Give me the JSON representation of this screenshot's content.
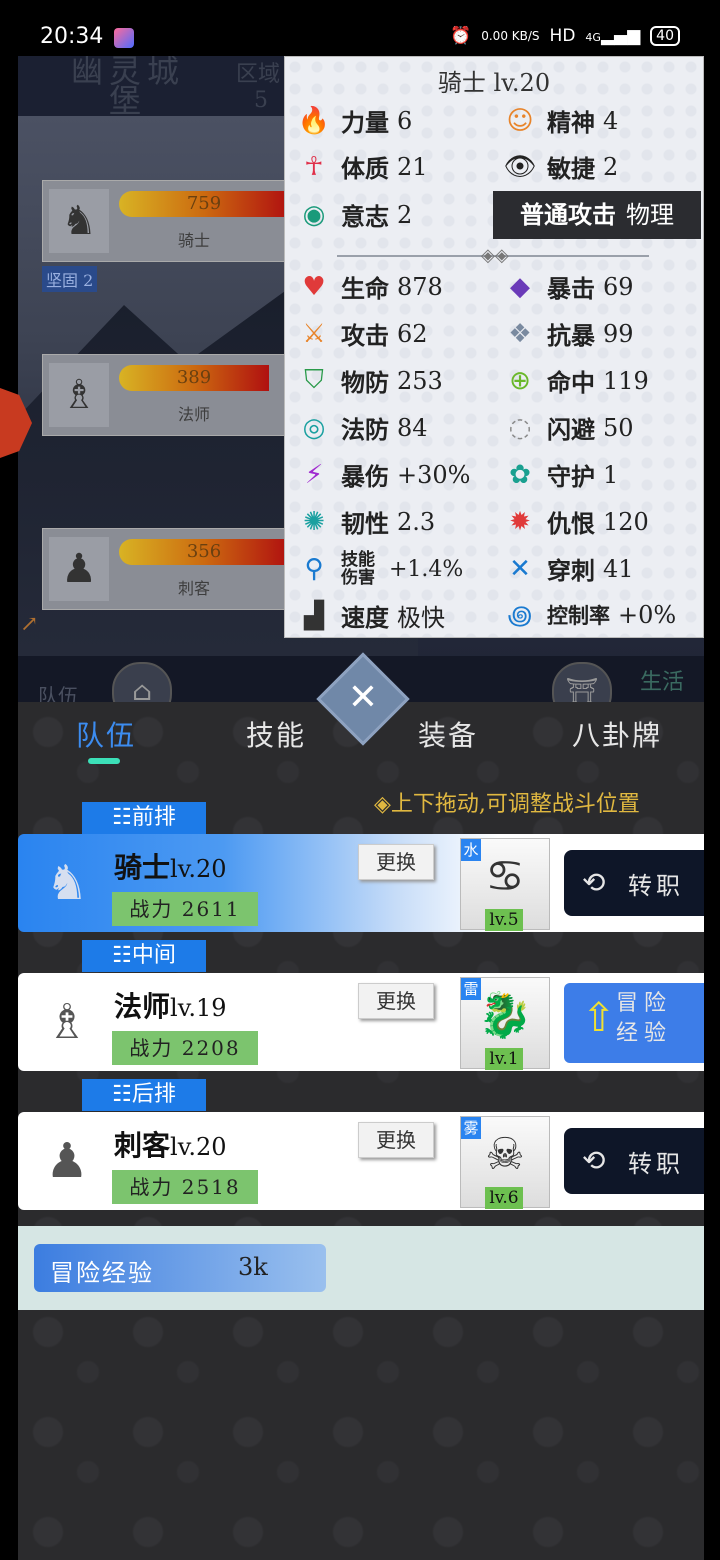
{
  "status_bar": {
    "time": "20:34",
    "net_speed": "0.00 KB/S",
    "hd": "HD",
    "signal": "4G",
    "battery": "40"
  },
  "battle": {
    "location_title": "幽灵城堡",
    "region_label": "区域",
    "region_number": "5",
    "units": [
      {
        "name": "骑士",
        "hp": "759",
        "icon": "knight-icon"
      },
      {
        "name": "法师",
        "hp": "389",
        "icon": "mage-icon"
      },
      {
        "name": "刺客",
        "hp": "356",
        "icon": "assassin-icon"
      }
    ],
    "buff": {
      "label": "坚固",
      "value": "2"
    },
    "left_label": "队伍",
    "right_label": "生活"
  },
  "stats_popup": {
    "title": "骑士 lv.20",
    "attributes": [
      {
        "icon": "fire-icon",
        "label": "力量",
        "value": "6"
      },
      {
        "icon": "mind-icon",
        "label": "精神",
        "value": "4"
      },
      {
        "icon": "body-icon",
        "label": "体质",
        "value": "21"
      },
      {
        "icon": "eye-icon",
        "label": "敏捷",
        "value": "2"
      },
      {
        "icon": "will-icon",
        "label": "意志",
        "value": "2"
      }
    ],
    "attack_type": {
      "label": "普通攻击",
      "value": "物理"
    },
    "stats": [
      {
        "icon": "heart-icon",
        "label": "生命",
        "value": "878"
      },
      {
        "icon": "crit-icon",
        "label": "暴击",
        "value": "69"
      },
      {
        "icon": "sword-icon",
        "label": "攻击",
        "value": "62"
      },
      {
        "icon": "anti-crit-icon",
        "label": "抗暴",
        "value": "99"
      },
      {
        "icon": "shield-icon",
        "label": "物防",
        "value": "253"
      },
      {
        "icon": "crosshair-icon",
        "label": "命中",
        "value": "119"
      },
      {
        "icon": "magic-def-icon",
        "label": "法防",
        "value": "84"
      },
      {
        "icon": "dodge-icon",
        "label": "闪避",
        "value": "50"
      },
      {
        "icon": "lightning-icon",
        "label": "暴伤",
        "value": "+30%"
      },
      {
        "icon": "guard-icon",
        "label": "守护",
        "value": "1"
      },
      {
        "icon": "toughness-icon",
        "label": "韧性",
        "value": "2.3"
      },
      {
        "icon": "hatred-icon",
        "label": "仇恨",
        "value": "120"
      },
      {
        "icon": "skill-dmg-icon",
        "label": "技能伤害",
        "value": "+1.4%"
      },
      {
        "icon": "pierce-icon",
        "label": "穿刺",
        "value": "41"
      },
      {
        "icon": "boot-icon",
        "label": "速度",
        "value": "极快"
      },
      {
        "icon": "control-icon",
        "label": "控制率",
        "value": "+0%"
      }
    ]
  },
  "tabs": [
    "队伍",
    "技能",
    "装备",
    "八卦牌"
  ],
  "hint": "◈上下拖动,可调整战斗位置",
  "rows": [
    {
      "row_label": "☷前排",
      "name": "骑士",
      "level": "lv.20",
      "power_label": "战力",
      "power": "2611",
      "swap": "更换",
      "pet_element": "水",
      "pet_level": "lv.5",
      "action": "转职"
    },
    {
      "row_label": "☷中间",
      "name": "法师",
      "level": "lv.19",
      "power_label": "战力",
      "power": "2208",
      "swap": "更换",
      "pet_element": "雷",
      "pet_level": "lv.1",
      "action": "冒险经验"
    },
    {
      "row_label": "☷后排",
      "name": "刺客",
      "level": "lv.20",
      "power_label": "战力",
      "power": "2518",
      "swap": "更换",
      "pet_element": "雾",
      "pet_level": "lv.6",
      "action": "转职"
    }
  ],
  "adventure_exp": {
    "label": "冒险经验",
    "value": "3k"
  },
  "colors": {
    "accent": "#2a84f0",
    "tab_indicator": "#3ce0b8",
    "hint": "#e0b840",
    "power_bg": "#7cc46e"
  }
}
